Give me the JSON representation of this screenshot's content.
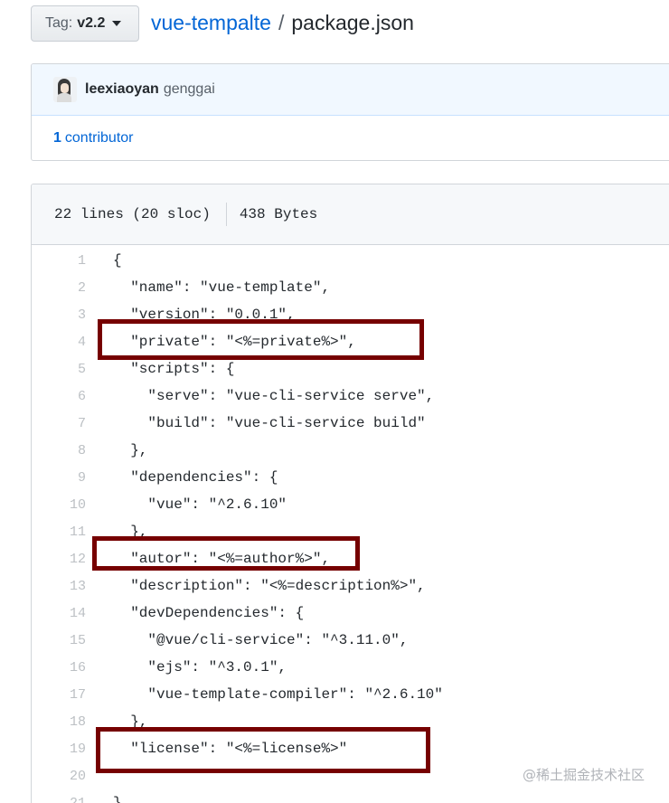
{
  "header": {
    "tag_prefix": "Tag:",
    "tag_value": "v2.2",
    "repo": "vue-tempalte",
    "separator": "/",
    "file": "package.json"
  },
  "commit": {
    "author": "leexiaoyan",
    "message": "genggai",
    "contributor_count": "1",
    "contributor_label": "contributor"
  },
  "file_info": {
    "lines": "22 lines (20 sloc)",
    "size": "438 Bytes"
  },
  "code_lines": [
    {
      "n": "1",
      "text": "{"
    },
    {
      "n": "2",
      "text": "  \"name\": \"vue-template\","
    },
    {
      "n": "3",
      "text": "  \"version\": \"0.0.1\","
    },
    {
      "n": "4",
      "text": "  \"private\": \"<%=private%>\","
    },
    {
      "n": "5",
      "text": "  \"scripts\": {"
    },
    {
      "n": "6",
      "text": "    \"serve\": \"vue-cli-service serve\","
    },
    {
      "n": "7",
      "text": "    \"build\": \"vue-cli-service build\""
    },
    {
      "n": "8",
      "text": "  },"
    },
    {
      "n": "9",
      "text": "  \"dependencies\": {"
    },
    {
      "n": "10",
      "text": "    \"vue\": \"^2.6.10\""
    },
    {
      "n": "11",
      "text": "  },"
    },
    {
      "n": "12",
      "text": "  \"autor\": \"<%=author%>\","
    },
    {
      "n": "13",
      "text": "  \"description\": \"<%=description%>\","
    },
    {
      "n": "14",
      "text": "  \"devDependencies\": {"
    },
    {
      "n": "15",
      "text": "    \"@vue/cli-service\": \"^3.11.0\","
    },
    {
      "n": "16",
      "text": "    \"ejs\": \"^3.0.1\","
    },
    {
      "n": "17",
      "text": "    \"vue-template-compiler\": \"^2.6.10\""
    },
    {
      "n": "18",
      "text": "  },"
    },
    {
      "n": "19",
      "text": "  \"license\": \"<%=license%>\""
    },
    {
      "n": "20",
      "text": ""
    },
    {
      "n": "21",
      "text": "}"
    }
  ],
  "highlight_color": "#760000",
  "watermark": "@稀土掘金技术社区"
}
